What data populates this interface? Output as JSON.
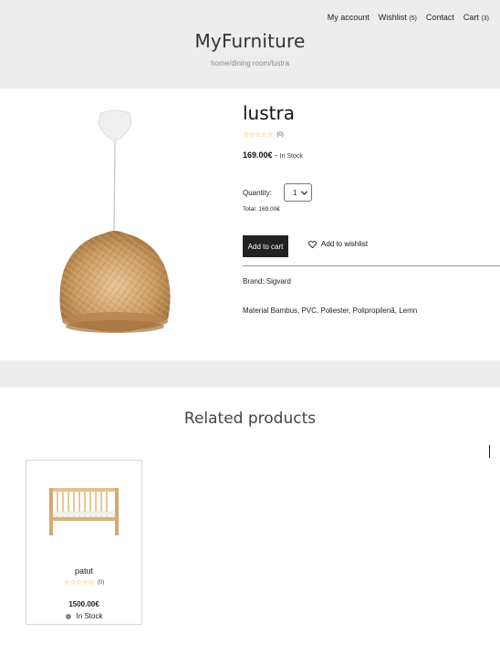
{
  "nav": {
    "account": "My account",
    "wishlist": "Wishlist",
    "wishlist_count": "(5)",
    "contact": "Contact",
    "cart": "Cart",
    "cart_count": "(3)"
  },
  "site": {
    "brand": "MyFurniture",
    "breadcrumb": "home/dining room/lustra"
  },
  "product": {
    "title": "lustra",
    "stars": "☆☆☆☆☆",
    "rating_count": "(0)",
    "price": "169.00€",
    "separator": " - ",
    "stock": "In Stock",
    "quantity_label": "Quantity:",
    "quantity_value": "1",
    "total": "Total: 169.00€",
    "add_to_cart": "Add to cart",
    "add_to_wishlist": "Add to wishlist",
    "brand": "Brand: Sigvard",
    "material": "Material Bambus, PVC, Poliester, Polipropilenă, Lemn"
  },
  "related": {
    "title": "Related products",
    "items": [
      {
        "name": "patut",
        "stars": "☆☆☆☆☆",
        "rating_count": "(0)",
        "price": "1500.00€",
        "stock": "In Stock"
      }
    ]
  },
  "colors": {
    "header_bg": "#ededed",
    "button_bg": "#222222",
    "star": "#e8b300"
  }
}
